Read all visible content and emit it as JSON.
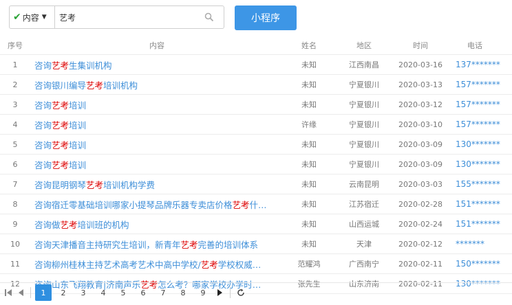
{
  "search": {
    "filter_label": "内容",
    "query": "艺考"
  },
  "mini_program_button": "小程序",
  "table": {
    "headers": {
      "num": "序号",
      "content": "内容",
      "name": "姓名",
      "area": "地区",
      "time": "时间",
      "phone": "电话"
    },
    "rows": [
      {
        "num": "1",
        "pre": "咨询",
        "hl": "艺考",
        "post": "生集训机构",
        "name": "未知",
        "area": "江西南昌",
        "time": "2020-03-16",
        "phone": "137*******"
      },
      {
        "num": "2",
        "pre": "咨询银川编导",
        "hl": "艺考",
        "post": "培训机构",
        "name": "未知",
        "area": "宁夏银川",
        "time": "2020-03-13",
        "phone": "157*******"
      },
      {
        "num": "3",
        "pre": "咨询",
        "hl": "艺考",
        "post": "培训",
        "name": "未知",
        "area": "宁夏银川",
        "time": "2020-03-12",
        "phone": "157*******"
      },
      {
        "num": "4",
        "pre": "咨询",
        "hl": "艺考",
        "post": "培训",
        "name": "许缘",
        "area": "宁夏银川",
        "time": "2020-03-10",
        "phone": "157*******"
      },
      {
        "num": "5",
        "pre": "咨询",
        "hl": "艺考",
        "post": "培训",
        "name": "未知",
        "area": "宁夏银川",
        "time": "2020-03-09",
        "phone": "130*******"
      },
      {
        "num": "6",
        "pre": "咨询",
        "hl": "艺考",
        "post": "培训",
        "name": "未知",
        "area": "宁夏银川",
        "time": "2020-03-09",
        "phone": "130*******"
      },
      {
        "num": "7",
        "pre": "咨询昆明钢琴",
        "hl": "艺考",
        "post": "培训机构学费",
        "name": "未知",
        "area": "云南昆明",
        "time": "2020-03-03",
        "phone": "155*******"
      },
      {
        "num": "8",
        "pre": "咨询宿迁零基础培训哪家小提琴品牌乐器专卖店价格",
        "hl": "艺考",
        "post": "什…",
        "name": "未知",
        "area": "江苏宿迁",
        "time": "2020-02-28",
        "phone": "151*******"
      },
      {
        "num": "9",
        "pre": "咨询做",
        "hl": "艺考",
        "post": "培训班的机构",
        "name": "未知",
        "area": "山西运城",
        "time": "2020-02-24",
        "phone": "151*******"
      },
      {
        "num": "10",
        "pre": "咨询天津播音主持研究生培训，新青年",
        "hl": "艺考",
        "post": "完善的培训体系",
        "name": "未知",
        "area": "天津",
        "time": "2020-02-12",
        "phone": "*******"
      },
      {
        "num": "11",
        "pre": "咨询柳州桂林主持艺术高考艺术中高中学校/",
        "hl": "艺考",
        "post": "学校权威…",
        "name": "范耀鸿",
        "area": "广西南宁",
        "time": "2020-02-11",
        "phone": "150*******"
      },
      {
        "num": "12",
        "pre": "咨询山东飞翔教育|济南声乐",
        "hl": "艺考",
        "post": "怎么考？哪家学校办学时…",
        "name": "张先生",
        "area": "山东济南",
        "time": "2020-02-11",
        "phone": "130*******"
      }
    ]
  },
  "pagination": {
    "pages": [
      "1",
      "2",
      "3",
      "4",
      "5",
      "6",
      "7",
      "8",
      "9"
    ],
    "current": "1"
  },
  "colors": {
    "accent": "#3d96e6",
    "link": "#3d8ed8",
    "highlight": "#dd0000",
    "check": "#2aa336"
  }
}
